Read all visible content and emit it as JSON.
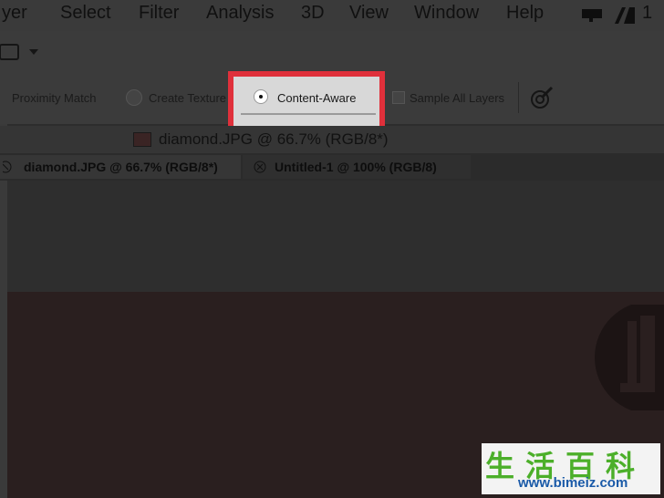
{
  "menubar": {
    "items": [
      "yer",
      "Select",
      "Filter",
      "Analysis",
      "3D",
      "View",
      "Window",
      "Help"
    ],
    "right_text": "1"
  },
  "options_bar": {
    "proximity_match": "Proximity Match",
    "create_texture": "Create Texture",
    "content_aware": "Content-Aware",
    "sample_all_layers": "Sample All Layers"
  },
  "document": {
    "title": "diamond.JPG @ 66.7% (RGB/8*)"
  },
  "tabs": [
    {
      "label": "diamond.JPG @ 66.7% (RGB/8*)"
    },
    {
      "label": "Untitled-1 @ 100% (RGB/8)"
    }
  ],
  "watermark": {
    "chinese": "生活百科",
    "url": "www.bimeiz.com"
  },
  "colors": {
    "highlight": "#e0303b",
    "watermark_green": "#4caf2a",
    "watermark_blue": "#1a5aa8"
  }
}
